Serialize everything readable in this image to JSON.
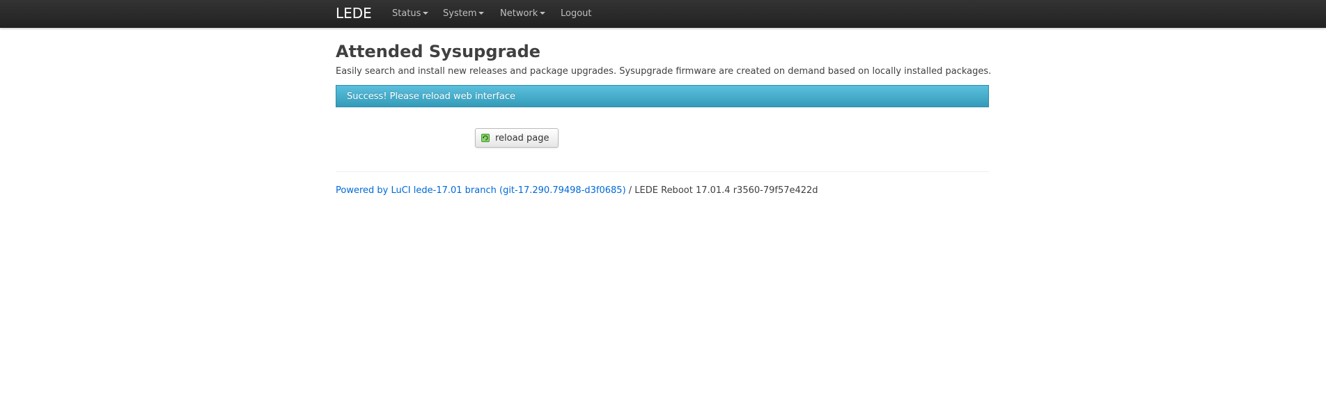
{
  "navbar": {
    "brand": "LEDE",
    "menu": [
      {
        "label": "Status",
        "dropdown": true
      },
      {
        "label": "System",
        "dropdown": true
      },
      {
        "label": "Network",
        "dropdown": true
      },
      {
        "label": "Logout",
        "dropdown": false
      }
    ]
  },
  "main": {
    "title": "Attended Sysupgrade",
    "description": "Easily search and install new releases and package upgrades. Sysupgrade firmware are created on demand based on locally installed packages.",
    "alert": "Success! Please reload web interface",
    "reload_button": {
      "label": "reload page",
      "icon": "reload-icon"
    }
  },
  "footer": {
    "link_text": "Powered by LuCI lede-17.01 branch (git-17.290.79498-d3f0685)",
    "separator_text": " / LEDE Reboot 17.01.4 r3560-79f57e422d"
  },
  "colors": {
    "navbar_bg": "#222222",
    "alert_bg": "#339bb9",
    "link": "#0069d6",
    "icon_green": "#3c9b2f"
  }
}
